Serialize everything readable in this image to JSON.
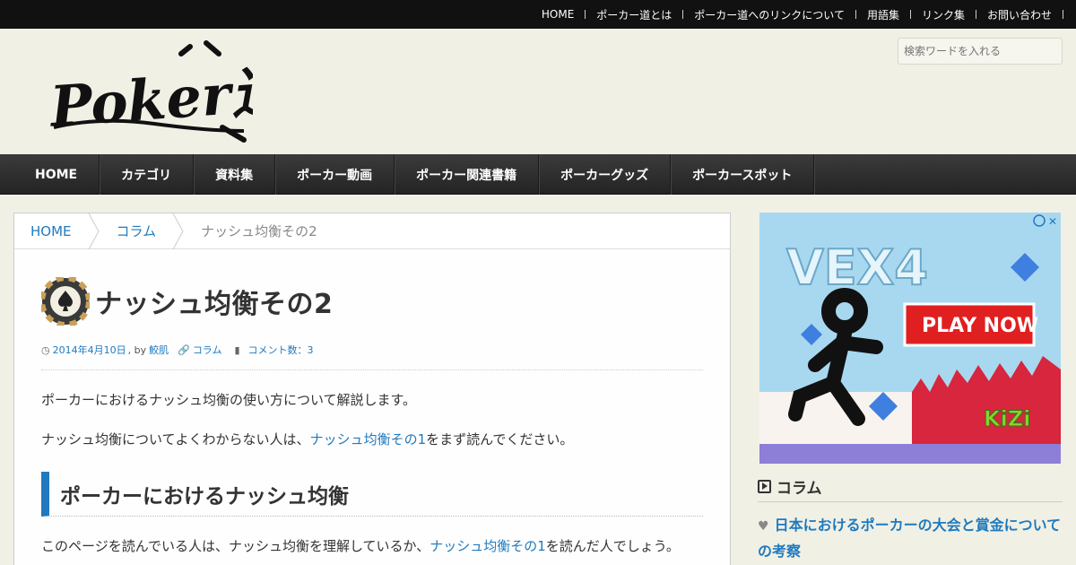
{
  "topbar": {
    "links": [
      "HOME",
      "ポーカー道とは",
      "ポーカー道へのリンクについて",
      "用語集",
      "リンク集",
      "お問い合わせ"
    ]
  },
  "header": {
    "logo_text": "Poker道",
    "search_placeholder": "検索ワードを入れる"
  },
  "nav": {
    "items": [
      "HOME",
      "カテゴリ",
      "資料集",
      "ポーカー動画",
      "ポーカー関連書籍",
      "ポーカーグッズ",
      "ポーカースポット"
    ]
  },
  "breadcrumb": {
    "home": "HOME",
    "category": "コラム",
    "current": "ナッシュ均衡その2"
  },
  "article": {
    "title": "ナッシュ均衡その2",
    "date": "2014年4月10日",
    "by": ", by",
    "author": "鮫肌",
    "category": "コラム",
    "comments": "コメント数：3",
    "p1": "ポーカーにおけるナッシュ均衡の使い方について解説します。",
    "p2_before": "ナッシュ均衡についてよくわからない人は、",
    "p2_link": "ナッシュ均衡その1",
    "p2_after": "をまず読んでください。",
    "h2": "ポーカーにおけるナッシュ均衡",
    "p3_before": "このページを読んでいる人は、ナッシュ均衡を理解しているか、",
    "p3_link": "ナッシュ均衡その1",
    "p3_after": "を読んだ人でしょう。"
  },
  "ad": {
    "game_title": "VEX4",
    "cta": "PLAY NOW",
    "brand": "KiZi"
  },
  "sidebar": {
    "section_title": "コラム",
    "post_title": "日本におけるポーカーの大会と賞金についての考察"
  },
  "colors": {
    "link": "#1f7abe",
    "topbar": "#111111",
    "nav": "#2f2f2f",
    "page_bg": "#f1f0e5"
  }
}
